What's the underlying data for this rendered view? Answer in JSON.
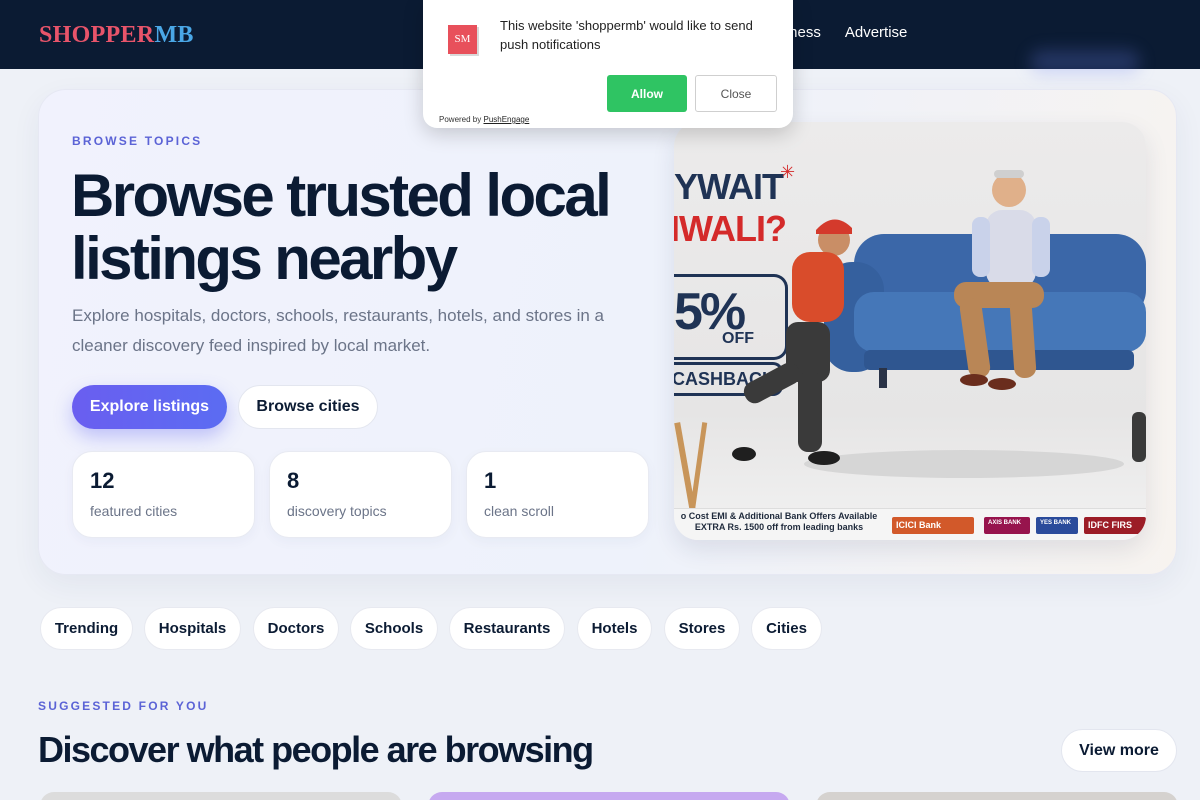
{
  "brand": {
    "part1": "SHOPPER",
    "part2": "MB"
  },
  "nav": {
    "links": [
      "usiness",
      "Advertise"
    ]
  },
  "push": {
    "icon_text": "SM",
    "message": "This website 'shoppermb' would like to send push notifications",
    "allow": "Allow",
    "close": "Close",
    "powered_by": "Powered by",
    "provider": "PushEngage"
  },
  "hero": {
    "eyebrow": "BROWSE TOPICS",
    "title": "Browse trusted local listings nearby",
    "description": "Explore hospitals, doctors, schools, restaurants, hotels, and stores in a cleaner discovery feed inspired by local market.",
    "primary_cta": "Explore listings",
    "secondary_cta": "Browse cities",
    "stats": [
      {
        "value": "12",
        "label": "featured cities"
      },
      {
        "value": "8",
        "label": "discovery topics"
      },
      {
        "value": "1",
        "label": "clean scroll"
      }
    ]
  },
  "banner": {
    "line1": "YWAIT",
    "line2": "IWALI?",
    "percent": "5%",
    "off": "OFF",
    "cashback": "CASHBACK",
    "strip_text": "o Cost EMI & Additional Bank Offers Available EXTRA Rs. 1500 off from leading banks",
    "banks": [
      "ICICI Bank",
      "AXIS BANK",
      "YES BANK",
      "IDFC FIRS"
    ]
  },
  "categories": [
    "Trending",
    "Hospitals",
    "Doctors",
    "Schools",
    "Restaurants",
    "Hotels",
    "Stores",
    "Cities"
  ],
  "suggested": {
    "eyebrow": "SUGGESTED FOR YOU",
    "title": "Discover what people are browsing",
    "view_more": "View more"
  },
  "colors": {
    "nav_bg": "#0b1b33",
    "brand_red": "#e8546a",
    "brand_blue": "#4aa7e6",
    "accent": "#5b63d6",
    "allow_green": "#2fc463"
  }
}
